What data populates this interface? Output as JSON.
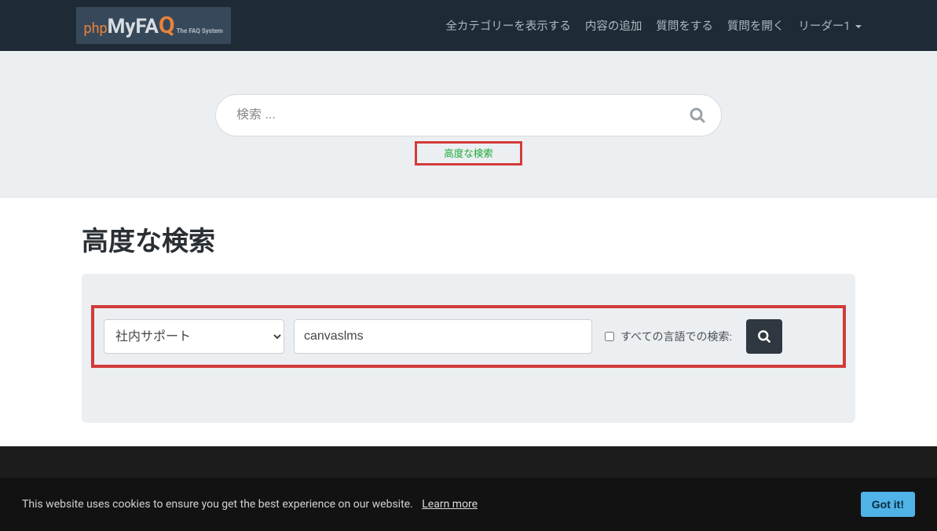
{
  "nav": {
    "links": [
      "全カテゴリーを表示する",
      "内容の追加",
      "質問をする",
      "質問を開く"
    ],
    "user": "リーダー1"
  },
  "logo": {
    "php": "php",
    "my": "My",
    "fa": "FA",
    "q": "Q",
    "sub": "The FAQ System"
  },
  "hero": {
    "placeholder": "検索 ...",
    "advanced_link": "高度な検索"
  },
  "page": {
    "title": "高度な検索"
  },
  "form": {
    "category_selected": "社内サポート",
    "term_value": "canvaslms",
    "all_langs_label": "すべての言語での検索:"
  },
  "cookie": {
    "text": "This website uses cookies to ensure you get the best experience on our website.",
    "learn": "Learn more",
    "button": "Got it!"
  }
}
